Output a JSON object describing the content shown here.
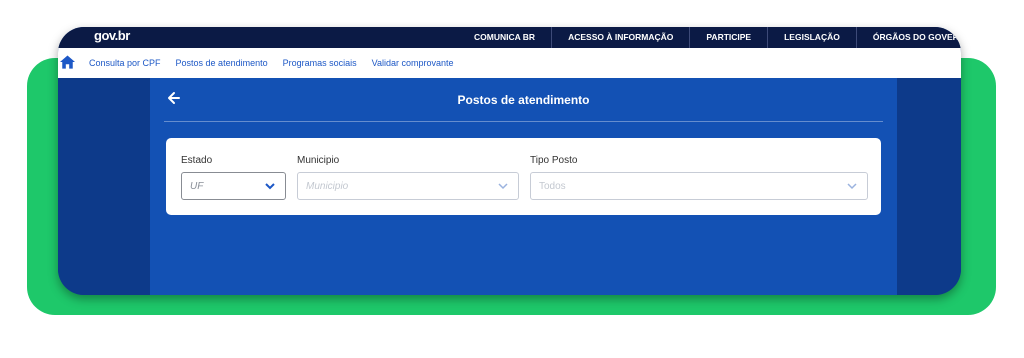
{
  "topbar": {
    "logo": "gov.br",
    "links": [
      "COMUNICA BR",
      "ACESSO À INFORMAÇÃO",
      "PARTICIPE",
      "LEGISLAÇÃO",
      "ÓRGÃOS DO GOVERNO"
    ]
  },
  "nav": {
    "home_icon": "home-icon",
    "links": [
      "Consulta por CPF",
      "Postos de atendimento",
      "Programas sociais",
      "Validar comprovante"
    ]
  },
  "page": {
    "back_icon": "arrow-left-icon",
    "title": "Postos de atendimento"
  },
  "form": {
    "estado": {
      "label": "Estado",
      "value": "UF"
    },
    "municipio": {
      "label": "Municipio",
      "placeholder": "Municipio"
    },
    "tipo_posto": {
      "label": "Tipo Posto",
      "placeholder": "Todos"
    }
  },
  "colors": {
    "frame_green": "#1ec86a",
    "topbar": "#0b1a45",
    "main_blue": "#1351b4",
    "side_blue": "#0d3a8a",
    "link_blue": "#1d58c6"
  }
}
